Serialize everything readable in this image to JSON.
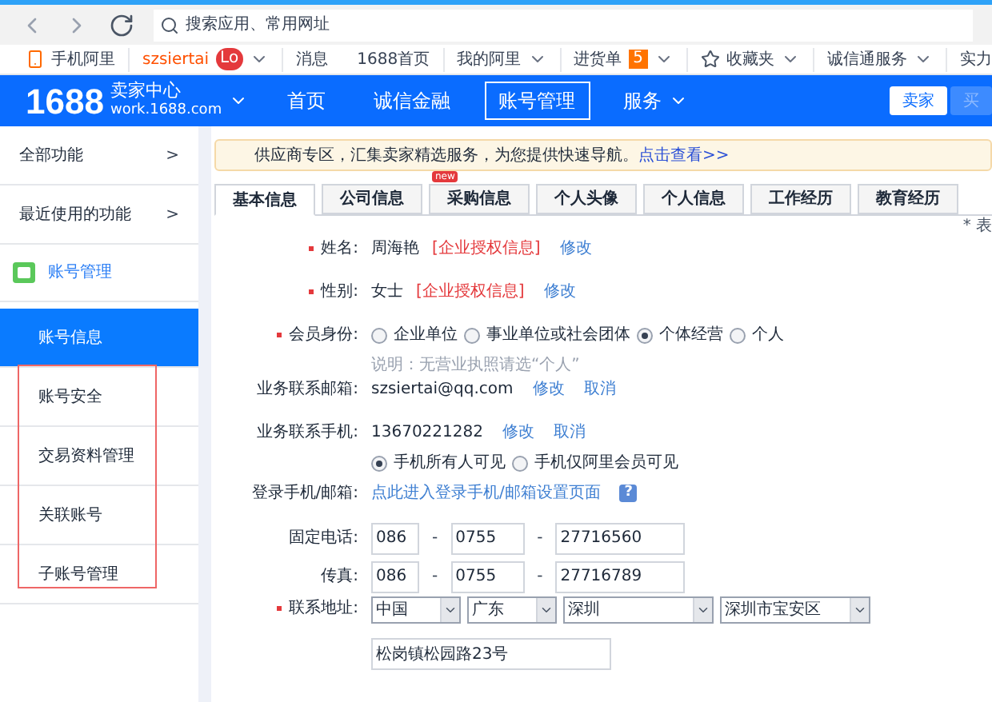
{
  "browser": {
    "search": {
      "placeholder": "搜索应用、常用网址"
    }
  },
  "topbar": {
    "left": [
      {
        "label": "手机阿里",
        "kind": "phone"
      },
      {
        "label": "szsiertai",
        "kind": "user",
        "badge": "Lo"
      },
      {
        "label": "消息",
        "kind": "plain"
      }
    ],
    "right": [
      {
        "label": "1688首页",
        "kind": "plain"
      },
      {
        "label": "我的阿里",
        "kind": "menu"
      },
      {
        "label": "进货单",
        "kind": "cart",
        "badge": "5"
      },
      {
        "label": "收藏夹",
        "kind": "star"
      },
      {
        "label": "诚信通服务",
        "kind": "menu"
      },
      {
        "label": "实力",
        "kind": "plain"
      }
    ]
  },
  "header": {
    "logo": "1688",
    "title": "卖家中心",
    "domain": "work.1688.com",
    "nav": [
      {
        "label": "首页",
        "selected": false
      },
      {
        "label": "诚信金融",
        "selected": false
      },
      {
        "label": "账号管理",
        "selected": true
      },
      {
        "label": "服务",
        "selected": false,
        "menu": true
      }
    ],
    "roles": [
      {
        "label": "卖家",
        "selected": true
      },
      {
        "label": "买",
        "selected": false
      }
    ]
  },
  "sidebar": {
    "sections": [
      {
        "label": "全部功能",
        "arrow": ">"
      },
      {
        "label": "最近使用的功能",
        "arrow": ">"
      }
    ],
    "group": "账号管理",
    "items": [
      {
        "label": "账号信息",
        "selected": true,
        "highlighted": false
      },
      {
        "label": "账号安全",
        "selected": false,
        "highlighted": true
      },
      {
        "label": "交易资料管理",
        "selected": false,
        "highlighted": true
      },
      {
        "label": "关联账号",
        "selected": false,
        "highlighted": true
      },
      {
        "label": "子账号管理",
        "selected": false,
        "highlighted": true
      }
    ]
  },
  "notice": {
    "text": "供应商专区，汇集卖家精选服务，为您提供快速导航。",
    "link": "点击查看>>"
  },
  "tabs": [
    {
      "label": "基本信息",
      "selected": true
    },
    {
      "label": "公司信息",
      "selected": false
    },
    {
      "label": "采购信息",
      "selected": false,
      "badge": "new"
    },
    {
      "label": "个人头像",
      "selected": false
    },
    {
      "label": "个人信息",
      "selected": false
    },
    {
      "label": "工作经历",
      "selected": false
    },
    {
      "label": "教育经历",
      "selected": false
    }
  ],
  "required_note": "* 表",
  "form": [
    {
      "kind": "text",
      "label": "姓名:",
      "required": true,
      "value": "周海艳",
      "tag": "[企业授权信息]",
      "links": [
        "修改"
      ]
    },
    {
      "kind": "text",
      "label": "性别:",
      "required": true,
      "value": "女士",
      "tag": "[企业授权信息]",
      "links": [
        "修改"
      ]
    },
    {
      "kind": "radio",
      "label": "会员身份:",
      "required": true,
      "options": [
        {
          "label": "企业单位",
          "selected": false
        },
        {
          "label": "事业单位或社会团体",
          "selected": false
        },
        {
          "label": "个体经营",
          "selected": true
        },
        {
          "label": "个人",
          "selected": false
        }
      ],
      "note": "说明：无营业执照请选“个人”"
    },
    {
      "kind": "text",
      "label": "业务联系邮箱:",
      "required": false,
      "value": "szsiertai@qq.com",
      "links": [
        "修改",
        "取消"
      ]
    },
    {
      "kind": "text",
      "label": "业务联系手机:",
      "required": false,
      "value": "13670221282",
      "links": [
        "修改",
        "取消"
      ],
      "options": [
        {
          "label": "手机所有人可见",
          "selected": true
        },
        {
          "label": "手机仅阿里会员可见",
          "selected": false
        }
      ]
    },
    {
      "kind": "link",
      "label": "登录手机/邮箱:",
      "required": false,
      "link": "点此进入登录手机/邮箱设置页面",
      "help": "?"
    },
    {
      "kind": "phone",
      "label": "固定电话:",
      "required": false,
      "parts": [
        "086",
        "0755",
        "27716560"
      ],
      "separator": "-"
    },
    {
      "kind": "phone",
      "label": "传真:",
      "required": false,
      "parts": [
        "086",
        "0755",
        "27716789"
      ],
      "separator": "-"
    },
    {
      "kind": "address",
      "label": "联系地址:",
      "required": true,
      "selects": [
        "中国",
        "广东",
        "深圳",
        "深圳市宝安区"
      ],
      "street": "松岗镇松园路23号"
    }
  ]
}
